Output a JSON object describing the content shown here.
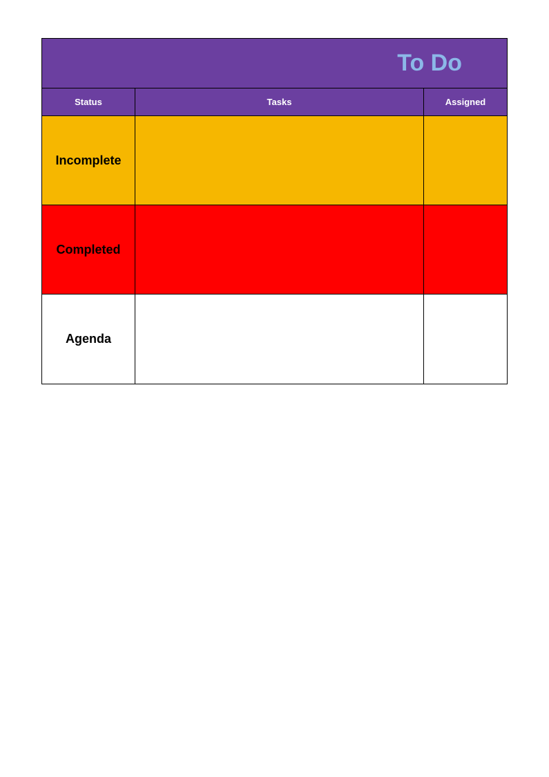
{
  "title": "To Do",
  "columns": {
    "status": "Status",
    "tasks": "Tasks",
    "assigned": "Assigned"
  },
  "rows": [
    {
      "status": "Incomplete",
      "tasks": "",
      "assigned": ""
    },
    {
      "status": "Completed",
      "tasks": "",
      "assigned": ""
    },
    {
      "status": "Agenda",
      "tasks": "",
      "assigned": ""
    }
  ],
  "colors": {
    "header_bg": "#6b3fa0",
    "title_text": "#8cb8e8",
    "incomplete_bg": "#f6b700",
    "completed_bg": "#ff0000",
    "agenda_bg": "#ffffff"
  }
}
